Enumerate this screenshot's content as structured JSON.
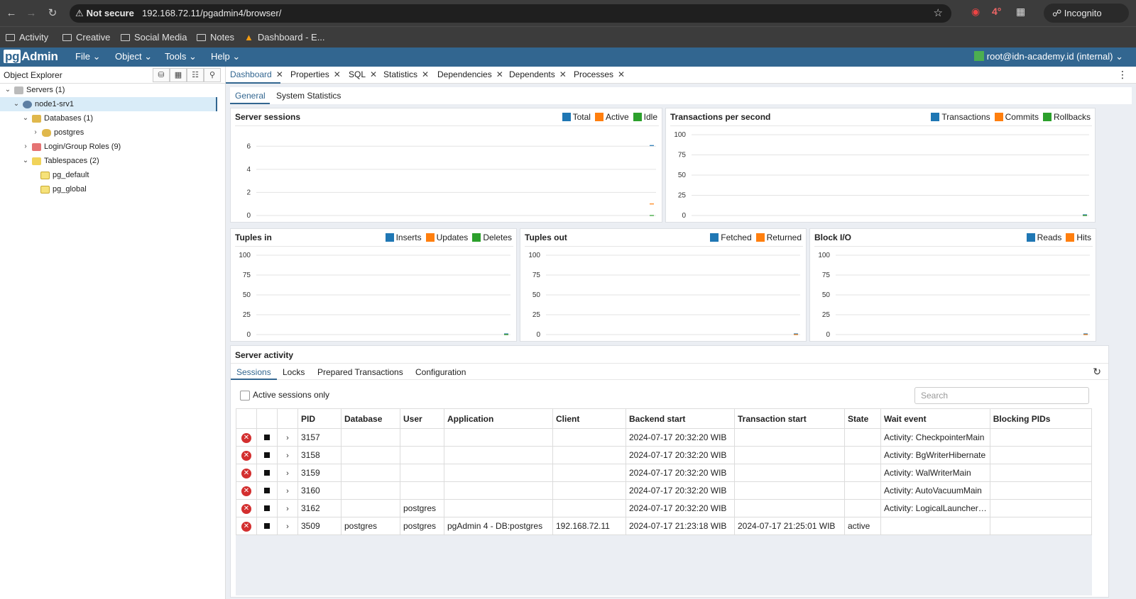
{
  "browser": {
    "omnibox_warning": "Not secure",
    "url": "192.168.72.11/pgadmin4/browser/",
    "ext_badge": "4°",
    "mode_label": "Incognito",
    "bookmarks": [
      "Activity",
      "Creative",
      "Social Media",
      "Notes",
      "Dashboard - E..."
    ]
  },
  "app": {
    "logo_pg": "pg",
    "logo_rest": "Admin",
    "menus": [
      "File",
      "Object",
      "Tools",
      "Help"
    ],
    "user": "root@idn-academy.id (internal)"
  },
  "explorer": {
    "title": "Object Explorer",
    "tree": {
      "servers": "Servers (1)",
      "server": "node1-srv1",
      "databases": "Databases (1)",
      "postgres": "postgres",
      "roles": "Login/Group Roles (9)",
      "tablespaces": "Tablespaces (2)",
      "pg_default": "pg_default",
      "pg_global": "pg_global"
    }
  },
  "tabs": [
    "Dashboard",
    "Properties",
    "SQL",
    "Statistics",
    "Dependencies",
    "Dependents",
    "Processes"
  ],
  "subtabs": [
    "General",
    "System Statistics"
  ],
  "colors": {
    "blue": "#1f77b4",
    "orange": "#ff7f0e",
    "green": "#2ca02c",
    "accent": "#326690"
  },
  "chart_data": [
    {
      "type": "line",
      "title": "Server sessions",
      "series": [
        {
          "name": "Total",
          "values": [
            6
          ]
        },
        {
          "name": "Active",
          "values": [
            1
          ]
        },
        {
          "name": "Idle",
          "values": [
            0
          ]
        }
      ],
      "yticks": [
        "0",
        "2",
        "4",
        "6"
      ],
      "ylim": [
        0,
        7
      ]
    },
    {
      "type": "line",
      "title": "Transactions per second",
      "series": [
        {
          "name": "Transactions",
          "values": [
            0
          ]
        },
        {
          "name": "Commits",
          "values": [
            0
          ]
        },
        {
          "name": "Rollbacks",
          "values": [
            0
          ]
        }
      ],
      "yticks": [
        "0",
        "25",
        "50",
        "75",
        "100"
      ],
      "ylim": [
        0,
        100
      ]
    },
    {
      "type": "line",
      "title": "Tuples in",
      "series": [
        {
          "name": "Inserts",
          "values": [
            0
          ]
        },
        {
          "name": "Updates",
          "values": [
            0
          ]
        },
        {
          "name": "Deletes",
          "values": [
            0
          ]
        }
      ],
      "yticks": [
        "0",
        "25",
        "50",
        "75",
        "100"
      ],
      "ylim": [
        0,
        100
      ]
    },
    {
      "type": "line",
      "title": "Tuples out",
      "series": [
        {
          "name": "Fetched",
          "values": [
            0
          ]
        },
        {
          "name": "Returned",
          "values": [
            0
          ]
        }
      ],
      "yticks": [
        "0",
        "25",
        "50",
        "75",
        "100"
      ],
      "ylim": [
        0,
        100
      ]
    },
    {
      "type": "line",
      "title": "Block I/O",
      "series": [
        {
          "name": "Reads",
          "values": [
            0
          ]
        },
        {
          "name": "Hits",
          "values": [
            0
          ]
        }
      ],
      "yticks": [
        "0",
        "25",
        "50",
        "75",
        "100"
      ],
      "ylim": [
        0,
        100
      ]
    }
  ],
  "activity": {
    "title": "Server activity",
    "tabs": [
      "Sessions",
      "Locks",
      "Prepared Transactions",
      "Configuration"
    ],
    "active_only_label": "Active sessions only",
    "search_placeholder": "Search",
    "columns": [
      "PID",
      "Database",
      "User",
      "Application",
      "Client",
      "Backend start",
      "Transaction start",
      "State",
      "Wait event",
      "Blocking PIDs"
    ],
    "rows": [
      [
        "3157",
        "",
        "",
        "",
        "",
        "2024-07-17 20:32:20 WIB",
        "",
        "",
        "Activity: CheckpointerMain",
        ""
      ],
      [
        "3158",
        "",
        "",
        "",
        "",
        "2024-07-17 20:32:20 WIB",
        "",
        "",
        "Activity: BgWriterHibernate",
        ""
      ],
      [
        "3159",
        "",
        "",
        "",
        "",
        "2024-07-17 20:32:20 WIB",
        "",
        "",
        "Activity: WalWriterMain",
        ""
      ],
      [
        "3160",
        "",
        "",
        "",
        "",
        "2024-07-17 20:32:20 WIB",
        "",
        "",
        "Activity: AutoVacuumMain",
        ""
      ],
      [
        "3162",
        "",
        "postgres",
        "",
        "",
        "2024-07-17 20:32:20 WIB",
        "",
        "",
        "Activity: LogicalLauncher…",
        ""
      ],
      [
        "3509",
        "postgres",
        "postgres",
        "pgAdmin 4 - DB:postgres",
        "192.168.72.11",
        "2024-07-17 21:23:18 WIB",
        "2024-07-17 21:25:01 WIB",
        "active",
        "",
        ""
      ]
    ]
  }
}
